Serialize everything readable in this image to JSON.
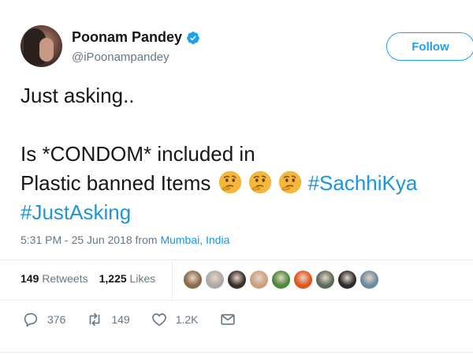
{
  "user": {
    "name": "Poonam Pandey",
    "handle": "@iPoonampandey"
  },
  "follow_label": "Follow",
  "tweet": {
    "line1": "Just asking..",
    "line2": "Is *CONDOM* included in",
    "line3": "Plastic banned Items ",
    "hashtag1": "#SachhiKya",
    "hashtag2": "#JustAsking",
    "emoji": "thinking-face"
  },
  "meta": {
    "time": "5:31 PM - 25 Jun 2018 from ",
    "location": "Mumbai, India"
  },
  "stats": {
    "retweets_count": "149",
    "retweets_label": "Retweets",
    "likes_count": "1,225",
    "likes_label": "Likes"
  },
  "liker_colors": [
    "#8a6a4a",
    "#a9a9a9",
    "#3a2e2a",
    "#c9a07e",
    "#4a8a3a",
    "#e2541e",
    "#5a6a5a",
    "#2b2b2b",
    "#6a8aa0"
  ],
  "actions": {
    "reply_count": "376",
    "retweet_count": "149",
    "like_count": "1.2K"
  },
  "colors": {
    "accent": "#1da1f2",
    "link": "#1b95e0",
    "muted": "#657786"
  }
}
